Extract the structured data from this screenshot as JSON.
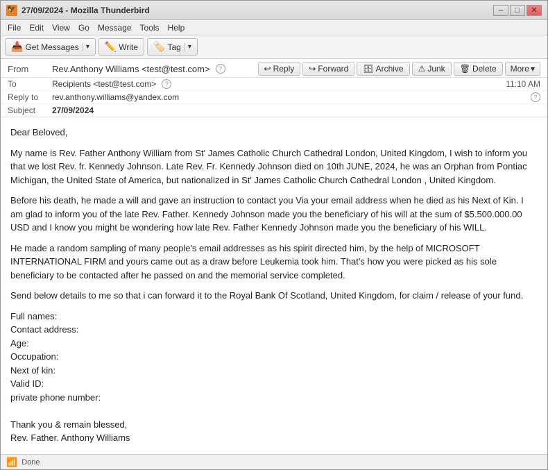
{
  "window": {
    "title": "27/09/2024 - Mozilla Thunderbird"
  },
  "title_bar": {
    "title": "27/09/2024 - Mozilla Thunderbird",
    "minimize_label": "–",
    "maximize_label": "□",
    "close_label": "✕"
  },
  "menu_bar": {
    "items": [
      "File",
      "Edit",
      "View",
      "Go",
      "Message",
      "Tools",
      "Help"
    ]
  },
  "toolbar": {
    "get_messages_label": "Get Messages",
    "write_label": "Write",
    "tag_label": "Tag"
  },
  "email_header_toolbar": {
    "reply_label": "Reply",
    "forward_label": "Forward",
    "archive_label": "Archive",
    "junk_label": "Junk",
    "delete_label": "Delete",
    "more_label": "More"
  },
  "fields": {
    "from_label": "From",
    "from_value": "Rev.Anthony Williams <test@test.com>",
    "to_label": "To",
    "to_value": "Recipients <test@test.com>",
    "replyto_label": "Reply to",
    "replyto_value": "rev.anthony.williams@yandex.com",
    "subject_label": "Subject",
    "subject_value": "27/09/2024",
    "time_value": "11:10 AM"
  },
  "body": {
    "greeting": "Dear Beloved,",
    "paragraph1": "My name is Rev. Father Anthony William from St' James Catholic Church Cathedral London, United Kingdom, I wish to inform you that we lost Rev. fr. Kennedy Johnson. Late Rev. Fr. Kennedy Johnson died on 10th JUNE, 2024, he was an Orphan from Pontiac Michigan, the United State of America, but nationalized in  St' James Catholic Church Cathedral London  , United Kingdom.",
    "paragraph2": "Before his death, he made a will and gave an instruction to contact you Via your email address when he died as his Next of Kin. I am glad to inform you of the late Rev. Father.  Kennedy Johnson made you the beneficiary of his will at the sum of $5.500.000.00 USD and I know you might be wondering how late Rev. Father Kennedy Johnson made you the beneficiary of his WILL.",
    "paragraph3": "He made a random sampling of many people's email addresses as his spirit directed him, by the help of MICROSOFT INTERNATIONAL FIRM and yours came out as a draw before Leukemia took him. That's how you were picked as his sole beneficiary to be contacted after he passed on and the memorial service completed.",
    "paragraph4": "Send below details to me so that i can forward it to the Royal Bank Of Scotland, United Kingdom, for claim / release of your fund.",
    "fields_intro": "",
    "field_fullnames": "Full names:",
    "field_contact": "Contact address:",
    "field_age": "Age:",
    "field_occupation": "Occupation:",
    "field_nextofkin": "Next of kin:",
    "field_validid": "Valid ID:",
    "field_phone": "private phone number:",
    "sign_thanks": "Thank you & remain blessed,",
    "sign_name": "Rev. Father. Anthony Williams"
  },
  "status_bar": {
    "status_text": "Done"
  }
}
